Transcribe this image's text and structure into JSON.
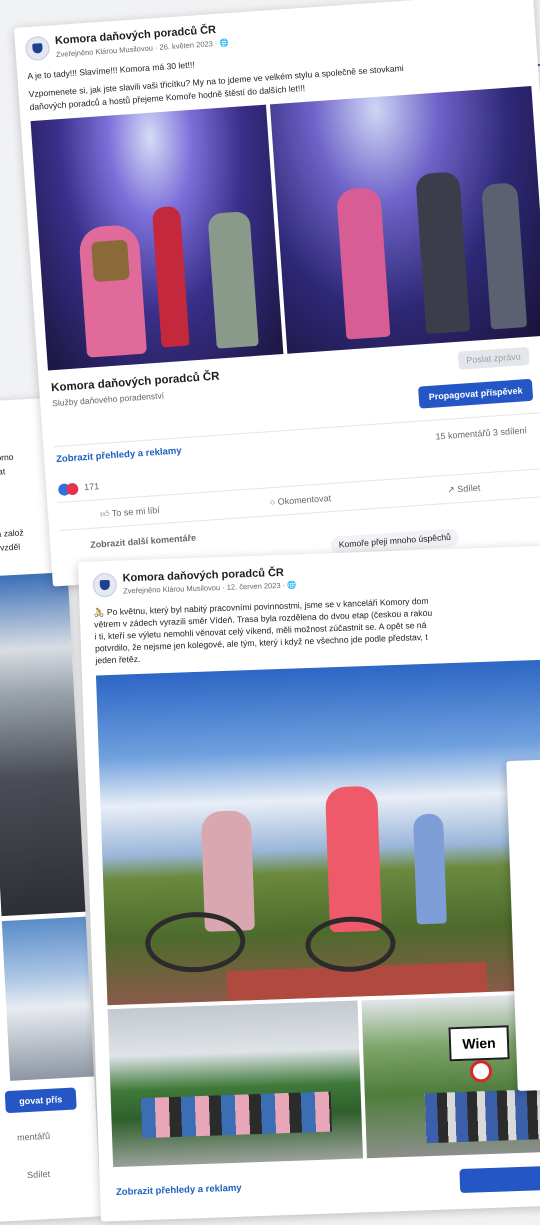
{
  "post1": {
    "page_name": "Komora daňových poradců ČR",
    "meta": "Zveřejněno Klárou Musilovou · 26. květen 2023 · 🌐",
    "line1": "A je to tady!!! Slavíme!!! Komora má 30 let!!!",
    "line2": "Vzpomenete si, jak jste slavili vaši třicítku? My na to jdeme ve velkém stylu a společně se stovkami",
    "line3": "daňových poradců a hostů přejeme Komoře hodně štěstí do dalších let!!!",
    "send_message": "Poslat zprávu",
    "footer_name": "Komora daňových poradců ČR",
    "footer_category": "Služby daňového poradenství",
    "promote": "Propagovat příspěvek",
    "insights": "Zobrazit přehledy a reklamy",
    "comments_shares": "15 komentářů   3 sdílení",
    "reactions_count": "171",
    "like": "To se mi líbí",
    "comment": "Okomentovat",
    "share": "Sdílet",
    "more_comments": "Zobrazit další komentáře",
    "comment_preview": "Komoře přeji mnoho úspěchů"
  },
  "post2": {
    "page_name": "Komora daňových poradců ČR",
    "meta": "Zveřejněno Klárou Musilovou · 12. červen 2023 · 🌐",
    "line1": "🚴 Po květnu, který byl nabitý pracovními povinnostmi, jsme se v kanceláři Komory dom",
    "line2": "větrem v zádech vyrazili směr Vídeň. Trasa byla rozdělena do dvou etap (českou a rakou",
    "line3": "i ti, kteří se výletu nemohli věnovat celý víkend, měli možnost zúčastnit se. A opět se ná",
    "line4": "potvrdilo, že nejsme jen kolegové, ale tým, který i když ne všechno jde podle představ, t",
    "line5": "jeden řetěz.",
    "sign": "Wien",
    "insights": "Zobrazit přehledy a reklamy"
  },
  "left_card": {
    "text1": "Výborno",
    "text2": "zdolat",
    "text3": "byla založ",
    "text4": "ujé vzděl",
    "promote": "govat přís",
    "comments": "mentářů",
    "share": "Sdílet"
  }
}
